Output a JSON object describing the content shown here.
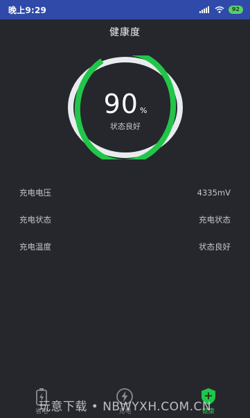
{
  "statusbar": {
    "time": "晚上9:29",
    "battery": "92"
  },
  "page": {
    "title": "健康度"
  },
  "gauge": {
    "value": "90",
    "unit": "%",
    "label": "状态良好",
    "fraction": 0.9,
    "color": "#22c549",
    "track": "#e9ecef"
  },
  "rows": [
    {
      "label": "充电电压",
      "value": "4335mV"
    },
    {
      "label": "充电状态",
      "value": "充电状态"
    },
    {
      "label": "充电温度",
      "value": "状态良好"
    }
  ],
  "tabs": [
    {
      "label": "省电",
      "icon": "battery-icon"
    },
    {
      "label": "充电",
      "icon": "lightning-icon"
    },
    {
      "label": "健康",
      "icon": "health-shield-icon",
      "active": true
    }
  ],
  "watermark": "玩意下载 • NBWYXH.COM.CN",
  "colors": {
    "background": "#25272d",
    "statusbar": "#2f4aa8",
    "accent": "#22c549"
  }
}
